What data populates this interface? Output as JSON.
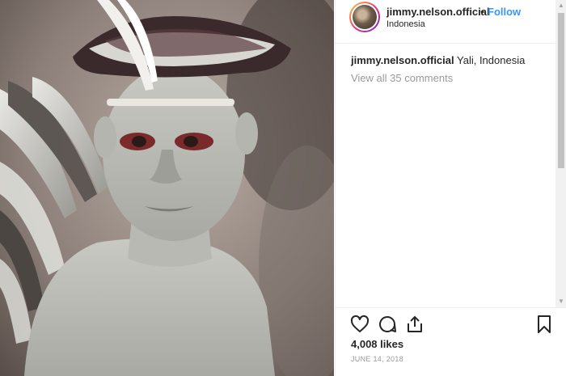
{
  "post": {
    "username": "jimmy.nelson.official",
    "separator": "•",
    "follow_label": "Follow",
    "location": "Indonesia",
    "caption_user": "jimmy.nelson.official",
    "caption_text": " Yali, Indonesia",
    "view_comments": "View all 35 comments",
    "likes": "4,008 likes",
    "date": "JUNE 14, 2018"
  },
  "icons": {
    "like": "heart-icon",
    "comment": "comment-icon",
    "share": "share-icon",
    "save": "bookmark-icon"
  },
  "colors": {
    "follow": "#3897f0",
    "text": "#262626",
    "muted": "#999999"
  }
}
